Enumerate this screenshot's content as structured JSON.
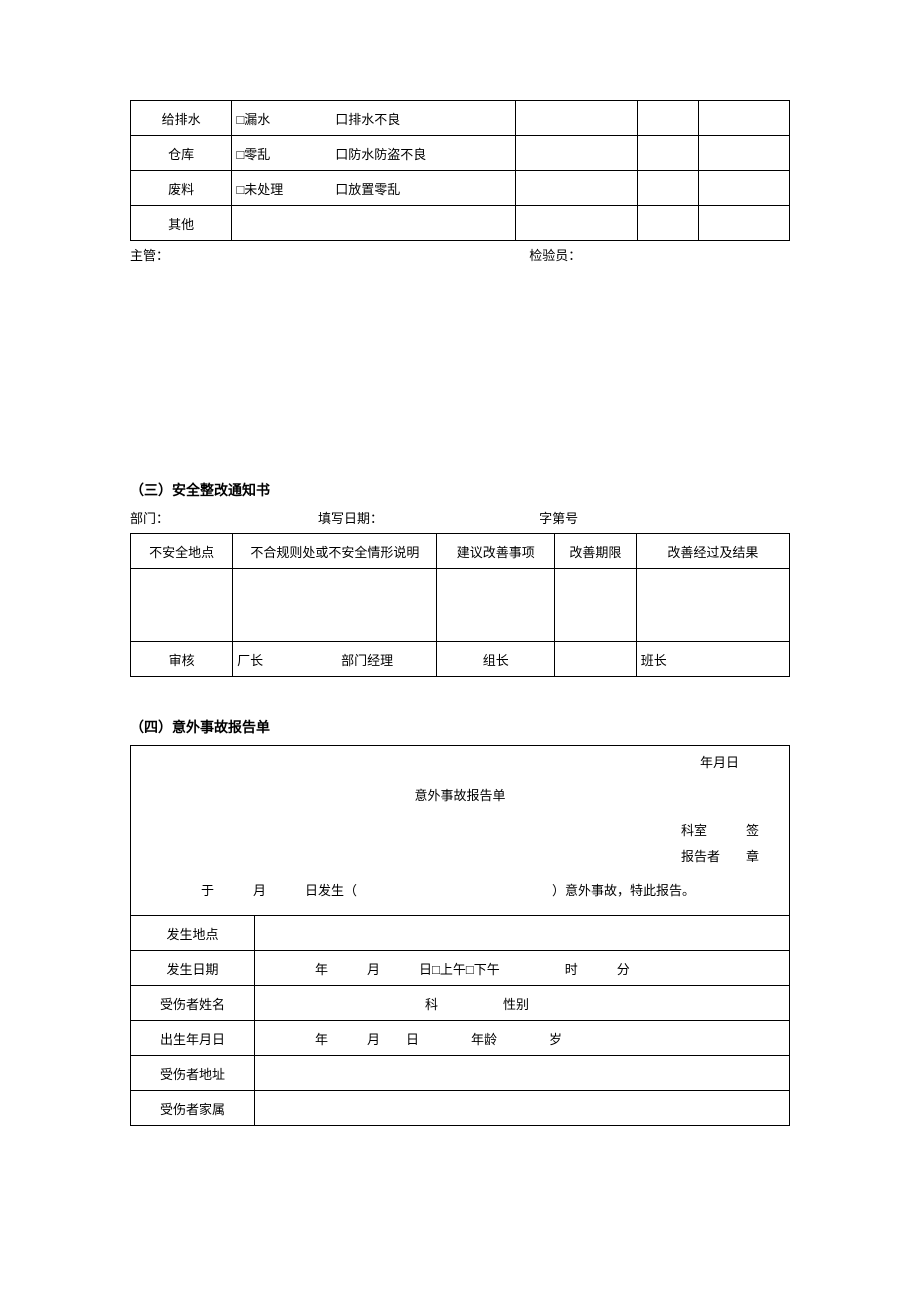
{
  "table1": {
    "rows": [
      {
        "item": "给排水",
        "check": "□漏水　　　　　口排水不良"
      },
      {
        "item": "仓库",
        "check": "□零乱　　　　　口防水防盗不良"
      },
      {
        "item": "废料",
        "check": "□未处理　　　　口放置零乱"
      },
      {
        "item": "其他",
        "check": ""
      }
    ],
    "footer": {
      "supervisor": "主管：",
      "inspector": "检验员："
    }
  },
  "section3": {
    "title": "（三）安全整改通知书",
    "meta": {
      "dept": "部门：",
      "date": "填写日期：",
      "doc": "字第号"
    },
    "headers": [
      "不安全地点",
      "不合规则处或不安全情形说明",
      "建议改善事项",
      "改善期限",
      "改善经过及结果"
    ],
    "review": {
      "label": "审核",
      "c1": "厂长　　　　　　部门经理",
      "c2": "组长",
      "c4": "班长"
    }
  },
  "section4": {
    "title": "（四）意外事故报告单",
    "date_header": "年月日",
    "report_title": "意外事故报告单",
    "right1": "科室　　　签",
    "right2": "报告者　　章",
    "sentence": "于　　　月　　　日发生（　　　　　　　　　　　　　　　）意外事故，特此报告。",
    "rows": {
      "place": {
        "label": "发生地点",
        "value": ""
      },
      "occur": {
        "label": "发生日期",
        "value": "年　　　月　　　日□上午□下午　　　　　时　　　分"
      },
      "name": {
        "label": "受伤者姓名",
        "value": "科　　　　　性别"
      },
      "birth": {
        "label": "出生年月日",
        "value": "年　　　月　　日　　　　年龄　　　　岁"
      },
      "address": {
        "label": "受伤者地址",
        "value": ""
      },
      "family": {
        "label": "受伤者家属",
        "value": ""
      }
    }
  }
}
